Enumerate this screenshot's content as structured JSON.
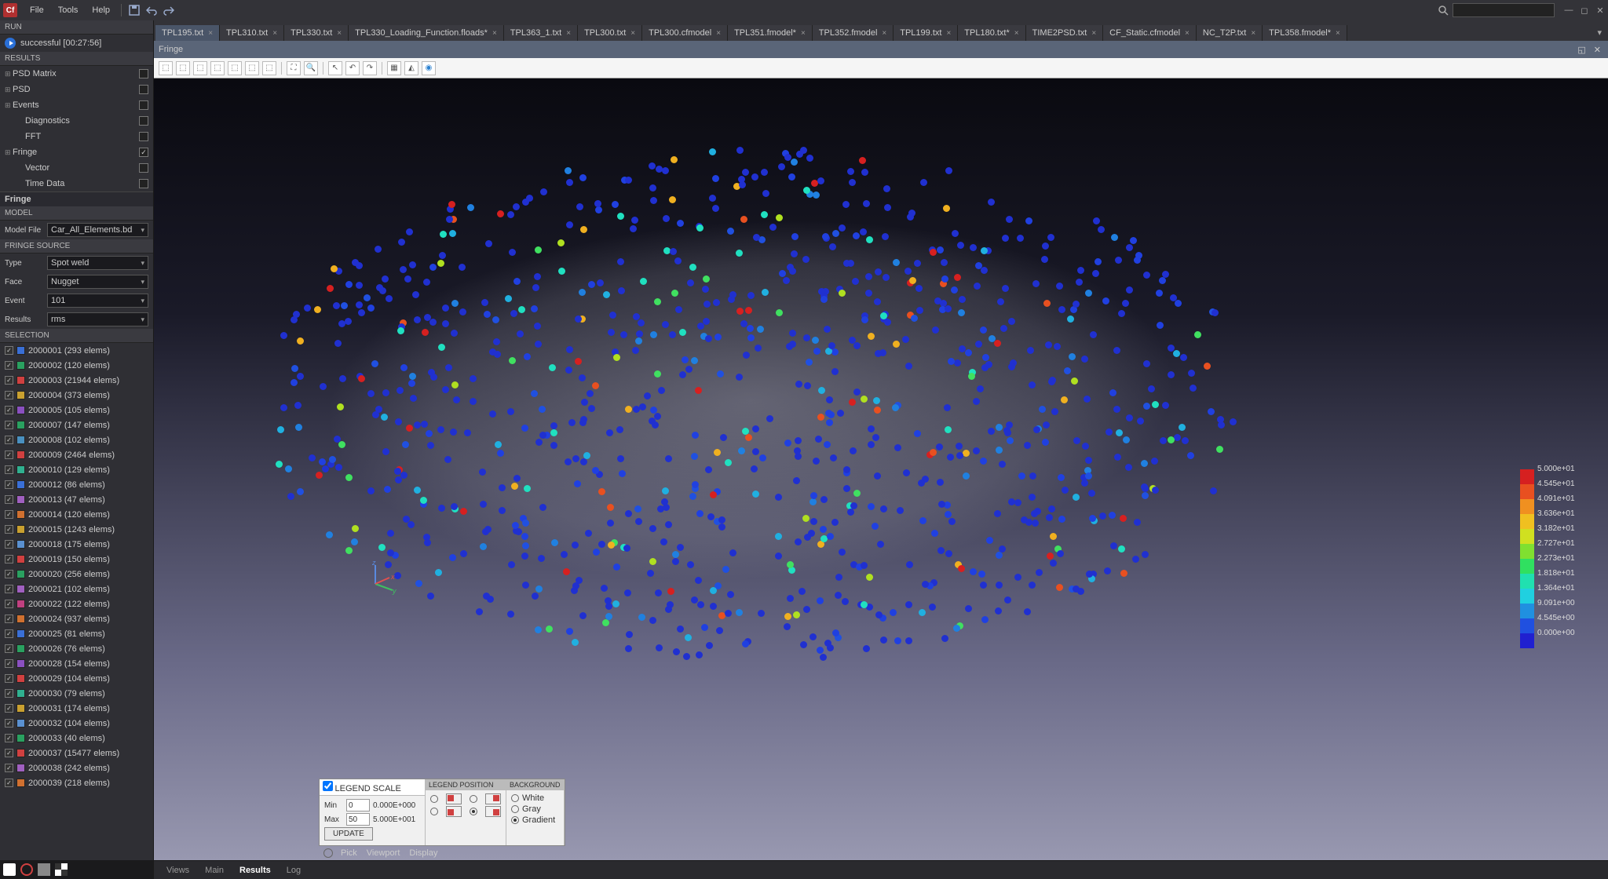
{
  "menu": {
    "items": [
      "File",
      "Tools",
      "Help"
    ]
  },
  "search": {
    "placeholder": ""
  },
  "run": {
    "header": "RUN",
    "status": "successful [00:27:56]"
  },
  "results": {
    "header": "RESULTS",
    "items": [
      {
        "label": "PSD Matrix",
        "exp": true,
        "checked": false,
        "indent": false
      },
      {
        "label": "PSD",
        "exp": true,
        "checked": false,
        "indent": false
      },
      {
        "label": "Events",
        "exp": true,
        "checked": false,
        "indent": false
      },
      {
        "label": "Diagnostics",
        "exp": false,
        "checked": false,
        "indent": true
      },
      {
        "label": "FFT",
        "exp": false,
        "checked": false,
        "indent": true
      },
      {
        "label": "Fringe",
        "exp": true,
        "checked": true,
        "indent": false
      },
      {
        "label": "Vector",
        "exp": false,
        "checked": false,
        "indent": true
      },
      {
        "label": "Time Data",
        "exp": false,
        "checked": false,
        "indent": true
      }
    ]
  },
  "fringe": {
    "header": "Fringe",
    "model_hdr": "MODEL",
    "model_label": "Model File",
    "model_file": "Car_All_Elements.bd",
    "source_hdr": "FRINGE SOURCE",
    "fields": [
      {
        "label": "Type",
        "value": "Spot weld"
      },
      {
        "label": "Face",
        "value": "Nugget"
      },
      {
        "label": "Event",
        "value": "101"
      },
      {
        "label": "Results",
        "value": "rms"
      }
    ]
  },
  "selection": {
    "header": "SELECTION",
    "items": [
      {
        "id": "2000001",
        "count": "293",
        "color": "#3a6fd6"
      },
      {
        "id": "2000002",
        "count": "120",
        "color": "#2aa060"
      },
      {
        "id": "2000003",
        "count": "21944",
        "color": "#d04040"
      },
      {
        "id": "2000004",
        "count": "373",
        "color": "#c9a030"
      },
      {
        "id": "2000005",
        "count": "105",
        "color": "#8a50c0"
      },
      {
        "id": "2000007",
        "count": "147",
        "color": "#2aa060"
      },
      {
        "id": "2000008",
        "count": "102",
        "color": "#4a90c0"
      },
      {
        "id": "2000009",
        "count": "2464",
        "color": "#d04040"
      },
      {
        "id": "2000010",
        "count": "129",
        "color": "#30b090"
      },
      {
        "id": "2000012",
        "count": "86",
        "color": "#3a6fd6"
      },
      {
        "id": "2000013",
        "count": "47",
        "color": "#a060c0"
      },
      {
        "id": "2000014",
        "count": "120",
        "color": "#d07030"
      },
      {
        "id": "2000015",
        "count": "1243",
        "color": "#c9a030"
      },
      {
        "id": "2000018",
        "count": "175",
        "color": "#5a90d0"
      },
      {
        "id": "2000019",
        "count": "150",
        "color": "#d04040"
      },
      {
        "id": "2000020",
        "count": "256",
        "color": "#2aa060"
      },
      {
        "id": "2000021",
        "count": "102",
        "color": "#a060c0"
      },
      {
        "id": "2000022",
        "count": "122",
        "color": "#c04080"
      },
      {
        "id": "2000024",
        "count": "937",
        "color": "#d07030"
      },
      {
        "id": "2000025",
        "count": "81",
        "color": "#3a6fd6"
      },
      {
        "id": "2000026",
        "count": "76",
        "color": "#2aa060"
      },
      {
        "id": "2000028",
        "count": "154",
        "color": "#8a50c0"
      },
      {
        "id": "2000029",
        "count": "104",
        "color": "#d04040"
      },
      {
        "id": "2000030",
        "count": "79",
        "color": "#30b090"
      },
      {
        "id": "2000031",
        "count": "174",
        "color": "#c9a030"
      },
      {
        "id": "2000032",
        "count": "104",
        "color": "#5a90d0"
      },
      {
        "id": "2000033",
        "count": "40",
        "color": "#2aa060"
      },
      {
        "id": "2000037",
        "count": "15477",
        "color": "#d04040"
      },
      {
        "id": "2000038",
        "count": "242",
        "color": "#a060c0"
      },
      {
        "id": "2000039",
        "count": "218",
        "color": "#d07030"
      }
    ]
  },
  "tabs": [
    {
      "label": "TPL195.txt",
      "active": true
    },
    {
      "label": "TPL310.txt"
    },
    {
      "label": "TPL330.txt"
    },
    {
      "label": "TPL330_Loading_Function.floads*"
    },
    {
      "label": "TPL363_1.txt"
    },
    {
      "label": "TPL300.txt"
    },
    {
      "label": "TPL300.cfmodel"
    },
    {
      "label": "TPL351.fmodel*"
    },
    {
      "label": "TPL352.fmodel"
    },
    {
      "label": "TPL199.txt"
    },
    {
      "label": "TPL180.txt*"
    },
    {
      "label": "TIME2PSD.txt"
    },
    {
      "label": "CF_Static.cfmodel"
    },
    {
      "label": "NC_T2P.txt"
    },
    {
      "label": "TPL358.fmodel*"
    }
  ],
  "sub_header": "Fringe",
  "legend_scale": {
    "header": "LEGEND SCALE",
    "min_label": "Min",
    "min_val": "0",
    "min_sci": "0.000E+000",
    "max_label": "Max",
    "max_val": "50",
    "max_sci": "5.000E+001",
    "update": "UPDATE"
  },
  "legend_pos": {
    "header": "LEGEND POSITION"
  },
  "background": {
    "header": "BACKGROUND",
    "options": [
      "White",
      "Gray",
      "Gradient"
    ],
    "selected": 2
  },
  "colorbar": [
    {
      "val": "5.000e+01",
      "color": "#d62020"
    },
    {
      "val": "4.545e+01",
      "color": "#e85020"
    },
    {
      "val": "4.091e+01",
      "color": "#f09020"
    },
    {
      "val": "3.636e+01",
      "color": "#f0c020"
    },
    {
      "val": "3.182e+01",
      "color": "#d0e020"
    },
    {
      "val": "2.727e+01",
      "color": "#80e030"
    },
    {
      "val": "2.273e+01",
      "color": "#30e060"
    },
    {
      "val": "1.818e+01",
      "color": "#20e0b0"
    },
    {
      "val": "1.364e+01",
      "color": "#20d0e0"
    },
    {
      "val": "9.091e+00",
      "color": "#2090e0"
    },
    {
      "val": "4.545e+00",
      "color": "#2050e0"
    },
    {
      "val": "0.000e+00",
      "color": "#2020d0"
    }
  ],
  "status_items": [
    "Pick",
    "Viewport",
    "Display"
  ],
  "bottom_tabs": [
    "Views",
    "Main",
    "Results",
    "Log"
  ],
  "bottom_active": 2,
  "axis": {
    "x": "x",
    "y": "y",
    "z": "z"
  }
}
